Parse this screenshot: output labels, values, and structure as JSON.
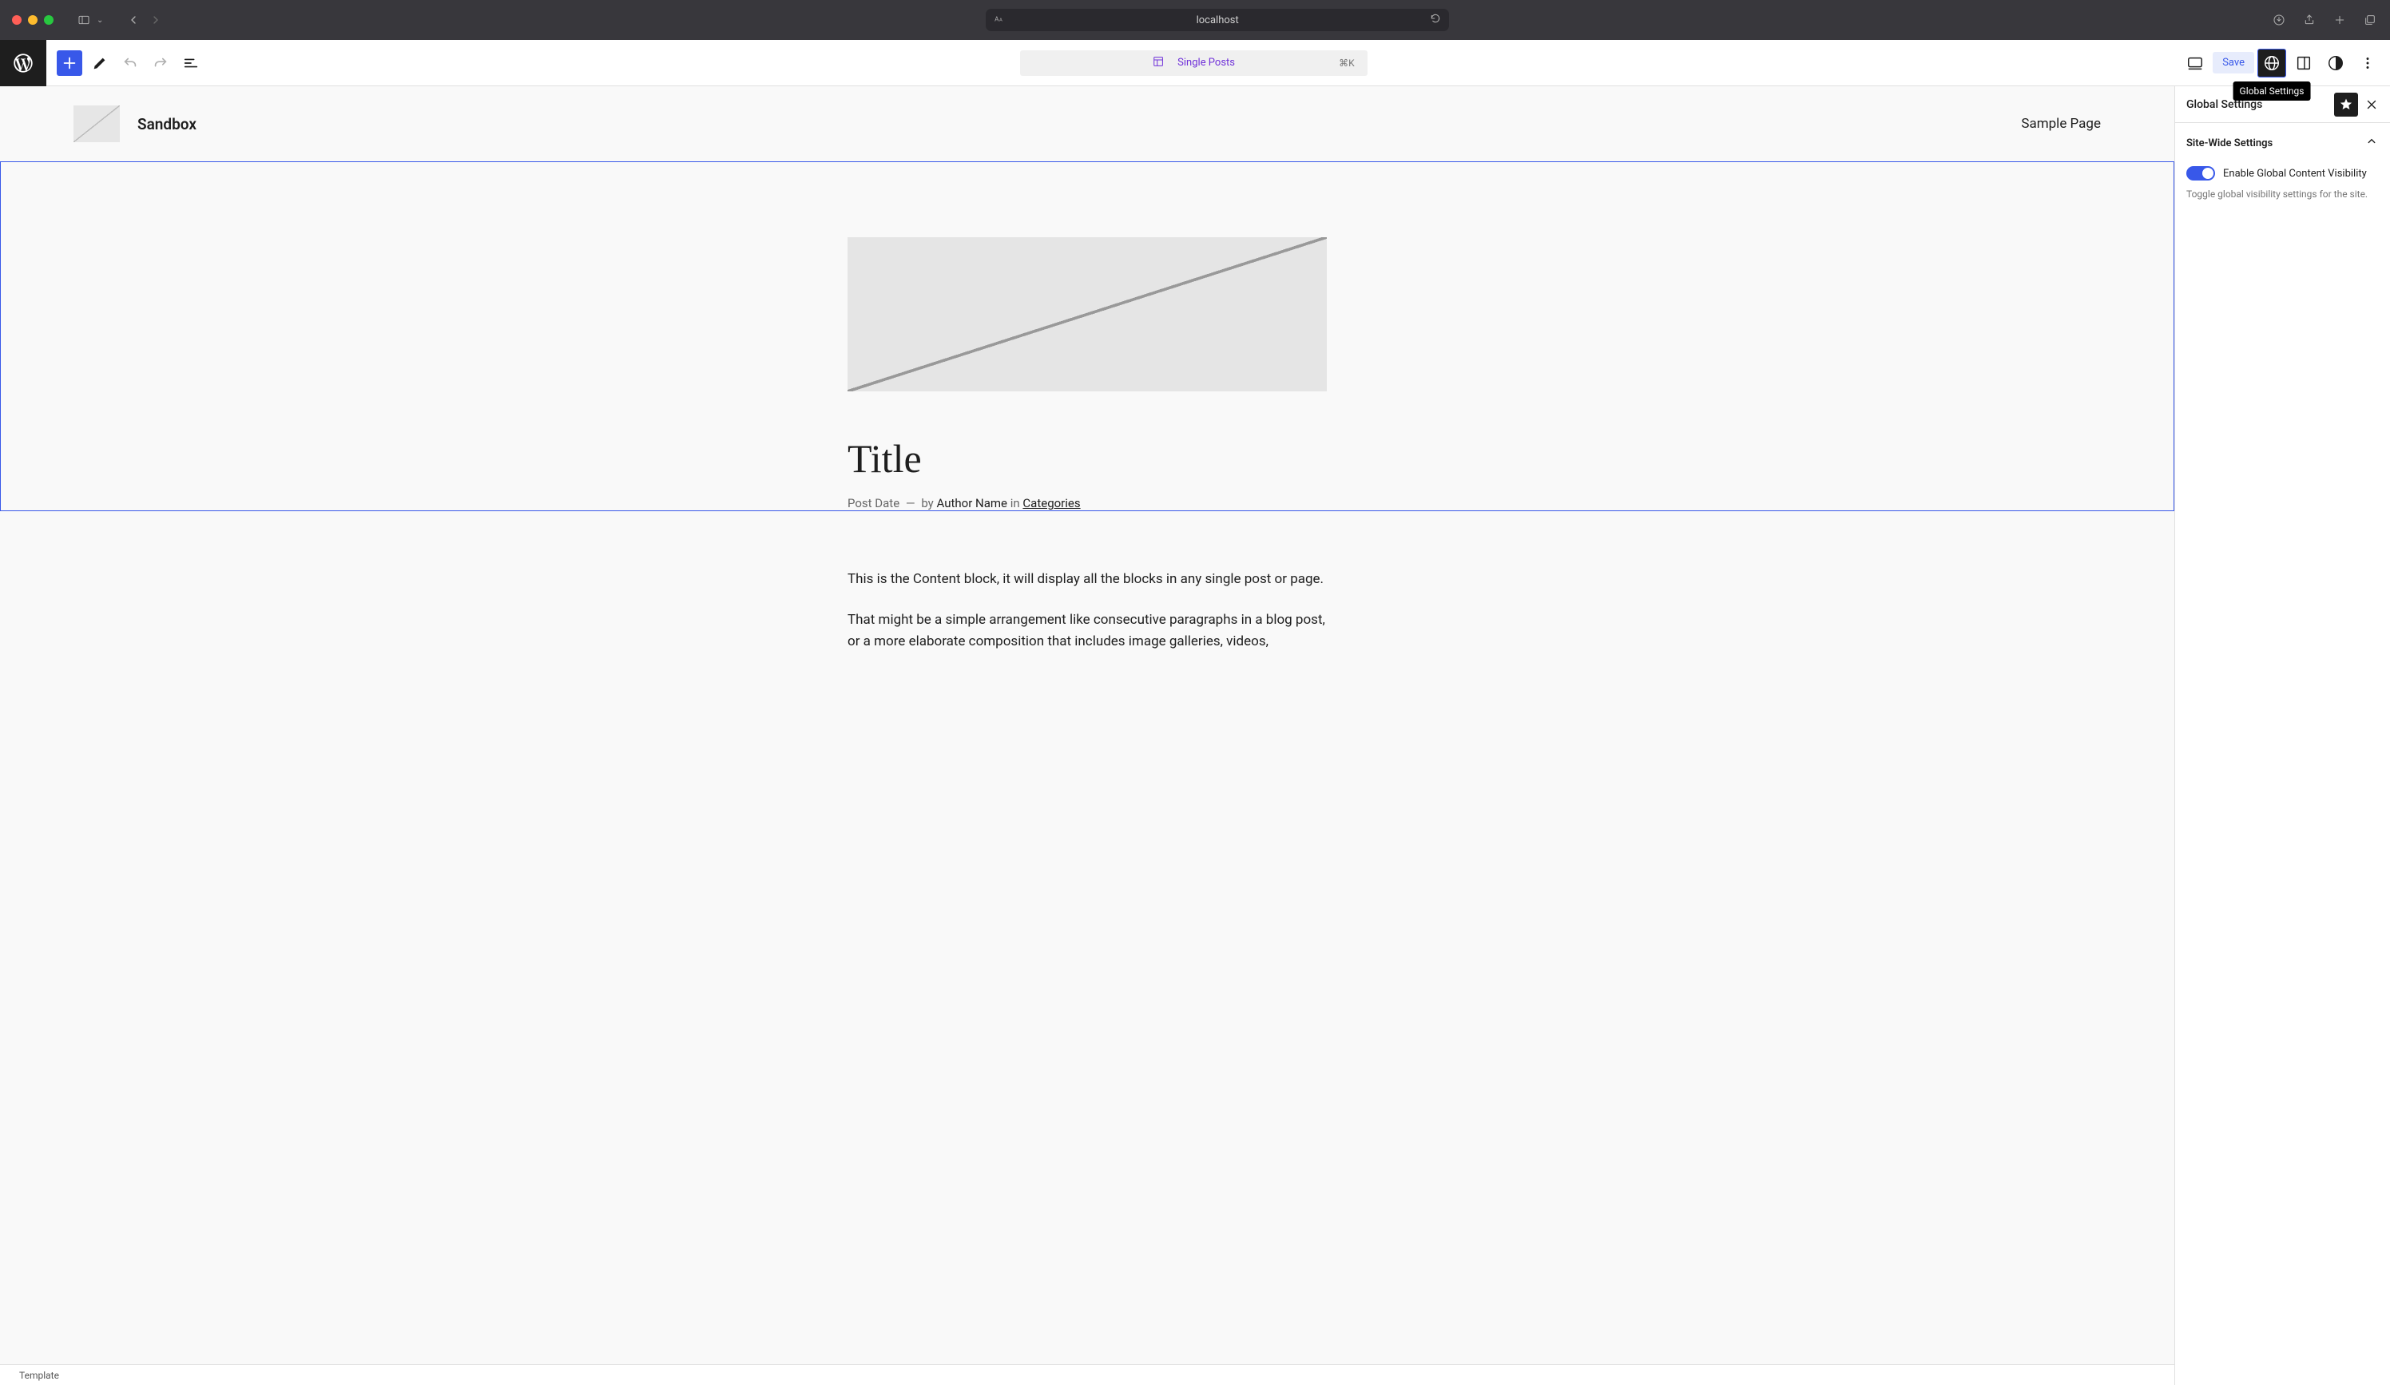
{
  "browser": {
    "url": "localhost"
  },
  "topbar": {
    "center_label": "Single Posts",
    "shortcut": "⌘K",
    "save_label": "Save",
    "tooltip": "Global Settings"
  },
  "site": {
    "title": "Sandbox",
    "nav": "Sample Page"
  },
  "post": {
    "title": "Title",
    "date": "Post Date",
    "by": "by",
    "author": "Author Name",
    "in": "in",
    "categories": "Categories",
    "p1": "This is the Content block, it will display all the blocks in any single post or page.",
    "p2": "That might be a simple arrangement like consecutive paragraphs in a blog post, or a more elaborate composition that includes image galleries, videos,"
  },
  "sidebar": {
    "title": "Global Settings",
    "section_title": "Site-Wide Settings",
    "toggle_label": "Enable Global Content Visibility",
    "desc": "Toggle global visibility settings for the site."
  },
  "bottom": {
    "breadcrumb": "Template"
  }
}
